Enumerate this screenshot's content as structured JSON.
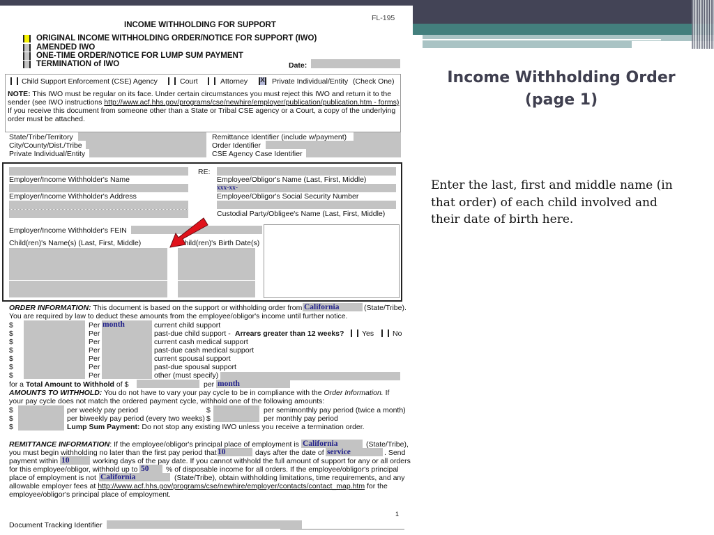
{
  "slide": {
    "title_line1": "Income Withholding Order",
    "title_line2": "(page 1)",
    "body": "Enter the last, first and middle name (in that order) of each child involved and their date of birth here.",
    "colors": {
      "banner_dark": "#434456",
      "banner_teal": "#437f7d",
      "banner_light": "#a9c3c4",
      "title": "#3f3f4f",
      "arrow": "#e0121b"
    }
  },
  "form": {
    "form_number": "FL-195",
    "title": "INCOME WITHHOLDING FOR SUPPORT",
    "order_types": [
      {
        "label": "ORIGINAL INCOME WITHHOLDING ORDER/NOTICE FOR SUPPORT (IWO)",
        "state": "highlighted"
      },
      {
        "label": "AMENDED IWO",
        "state": "empty"
      },
      {
        "label": "ONE-TIME ORDER/NOTICE FOR LUMP SUM PAYMENT",
        "state": "empty"
      },
      {
        "label": "TERMINATION of IWO",
        "state": "empty"
      }
    ],
    "date_label": "Date:",
    "sender_types": [
      {
        "label": "Child Support Enforcement (CSE) Agency",
        "mark": ""
      },
      {
        "label": "Court",
        "mark": ""
      },
      {
        "label": "Attorney",
        "mark": ""
      },
      {
        "label": "Private Individual/Entity",
        "mark": "X"
      }
    ],
    "check_one": "(Check One)",
    "note_bold": "NOTE:",
    "note_line1": "This IWO must be regular on its face. Under certain circumstances you must reject this IWO and return it to the",
    "note_line2_pre": "sender (see IWO instructions ",
    "note_link": "http://www.acf.hhs.gov/programs/cse/newhire/employer/publication/publication.htm - forms)",
    "note_line3": "If you receive this document from someone other than a State or Tribal CSE agency or a Court, a copy of the underlying",
    "note_line4": "order must be attached.",
    "ids_left": [
      "State/Tribe/Territory",
      "City/County/Dist./Tribe",
      "Private Individual/Entity"
    ],
    "ids_right": [
      "Remittance Identifier (include w/payment)",
      "Order Identifier",
      "CSE Agency Case Identifier"
    ],
    "re_label": "RE:",
    "employer_name": "Employer/Income Withholder's Name",
    "employer_address": "Employer/Income Withholder's Address",
    "employer_fein": "Employer/Income Withholder's FEIN",
    "employee_name": "Employee/Obligor's Name (Last, First, Middle)",
    "ssn_value": "xxx-xx-",
    "employee_ssn": "Employee/Obligor's Social Security Number",
    "custodial_name": "Custodial Party/Obligee's Name (Last, First, Middle)",
    "children_names": "Child(ren)'s Name(s) (Last, First, Middle)",
    "children_birth": "Child(ren)'s Birth Date(s)",
    "order_info": {
      "heading": "ORDER INFORMATION:",
      "text1": "This document is based on the support or withholding order from",
      "state": "California",
      "state_suffix": "(State/Tribe).",
      "text2": "You are required by law to deduct these amounts from the employee/obligor's income until further notice.",
      "dollar": "$",
      "per": "Per",
      "lines": [
        {
          "per_value": "month",
          "desc": "current child support"
        },
        {
          "per_value": "",
          "desc": "past-due child support -"
        },
        {
          "per_value": "",
          "desc": "current cash medical support"
        },
        {
          "per_value": "",
          "desc": "past-due cash medical support"
        },
        {
          "per_value": "",
          "desc": "current spousal support"
        },
        {
          "per_value": "",
          "desc": "past-due spousal support"
        },
        {
          "per_value": "",
          "desc": "other (must specify)"
        }
      ],
      "arrears_question": "Arrears greater than 12 weeks?",
      "yes": "Yes",
      "no": "No",
      "total_pre": "for a",
      "total_bold": "Total Amount to Withhold",
      "total_of": "of $",
      "total_per": "per",
      "total_per_value": "month"
    },
    "amounts": {
      "heading": "AMOUNTS TO WITHHOLD:",
      "text1": "You do not have to vary your pay cycle to be in compliance with the",
      "text1_italic": "Order Information.",
      "text1_end": "If",
      "text2": "your pay cycle does not match the ordered payment cycle, withhold one of the following amounts:",
      "weekly": "per weekly pay period",
      "semimonthly": "per semimonthly pay period (twice a month)",
      "biweekly": "per biweekly pay period (every two weeks)",
      "monthly": "per monthly pay period",
      "lump_bold": "Lump Sum Payment:",
      "lump_text": "Do not stop any existing IWO unless you receive a termination order."
    },
    "remittance": {
      "heading": "REMITTANCE INFORMATION",
      "l1_pre": ": If the employee/obligor's principal place of employment is",
      "state": "California",
      "l1_post": "(State/Tribe),",
      "l2_pre": "you must begin withholding no later than the first pay period that occur",
      "days": "10",
      "l2_mid": "days after the date of",
      "service": "service",
      "l2_post": ". Send",
      "l3_pre": "payment within",
      "working_days": "10",
      "l3_post": "working days of the pay date. If you cannot withhold the full amount of support for any or all orders",
      "l4_pre": "for this employee/obligor, withhold up to",
      "percent": "50",
      "l4_post": "% of disposable income for all orders. If the employee/obligor's principal",
      "l5_pre": "place of employment is not",
      "state_not": "California",
      "l5_post": "(State/Tribe), obtain withholding limitations, time requirements, and any",
      "l6_pre": "allowable employer fees at",
      "link": "http://www.acf.hhs.gov/programs/cse/newhire/employer/contacts/contact_map.htm",
      "l6_post": "for the",
      "l7": "employee/obligor's principal place of employment."
    },
    "page_number": "1",
    "tracking_label": "Document Tracking Identifier"
  }
}
